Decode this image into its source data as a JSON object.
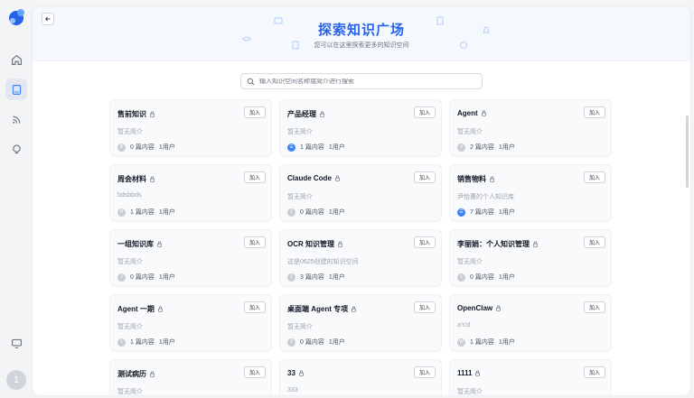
{
  "hero": {
    "title": "探索知识广场",
    "subtitle": "您可以在这里探索更多的知识空间"
  },
  "search": {
    "placeholder": "输入知识空间名称或简介进行搜索"
  },
  "join_label": "加入",
  "user": {
    "avatar_initial": "1"
  },
  "cards": [
    {
      "name": "售前知识",
      "desc": "暂无简介",
      "avatar": "B",
      "avatar_color": "gray",
      "docs": "0 篇内容",
      "users": "1用户"
    },
    {
      "name": "产品经理",
      "desc": "暂无简介",
      "avatar": "☰",
      "avatar_color": "blue",
      "docs": "1 篇内容",
      "users": "1用户"
    },
    {
      "name": "Agent",
      "desc": "暂无简介",
      "avatar": "4",
      "avatar_color": "gray",
      "docs": "2 篇内容",
      "users": "1用户"
    },
    {
      "name": "周会材料",
      "desc": "bdsbbds",
      "avatar": "H",
      "avatar_color": "gray",
      "docs": "1 篇内容",
      "users": "1用户"
    },
    {
      "name": "Claude Code",
      "desc": "暂无简介",
      "avatar": "1",
      "avatar_color": "gray",
      "docs": "0 篇内容",
      "users": "1用户"
    },
    {
      "name": "销售物料",
      "desc": "尹怡惠的个人知识库",
      "avatar": "☰",
      "avatar_color": "blue",
      "docs": "7 篇内容",
      "users": "1用户"
    },
    {
      "name": "一组知识库",
      "desc": "暂无简介",
      "avatar": "J",
      "avatar_color": "gray",
      "docs": "0 篇内容",
      "users": "1用户"
    },
    {
      "name": "OCR 知识管理",
      "desc": "这是0625创建的知识空间",
      "avatar": "1",
      "avatar_color": "gray",
      "docs": "3 篇内容",
      "users": "1用户"
    },
    {
      "name": "李丽娟：个人知识管理",
      "desc": "暂无简介",
      "avatar": "1",
      "avatar_color": "gray",
      "docs": "0 篇内容",
      "users": "1用户"
    },
    {
      "name": "Agent 一期",
      "desc": "暂无简介",
      "avatar": "1",
      "avatar_color": "gray",
      "docs": "1 篇内容",
      "users": "1用户"
    },
    {
      "name": "桌面端 Agent 专项",
      "desc": "暂无简介",
      "avatar": "2",
      "avatar_color": "gray",
      "docs": "0 篇内容",
      "users": "1用户"
    },
    {
      "name": "OpenClaw",
      "desc": "a's'd",
      "avatar": "W",
      "avatar_color": "gray",
      "docs": "1 篇内容",
      "users": "1用户"
    },
    {
      "name": "测试病历",
      "desc": "暂无简介",
      "avatar": "",
      "avatar_color": "gray",
      "docs": "",
      "users": ""
    },
    {
      "name": "33",
      "desc": "333",
      "avatar": "",
      "avatar_color": "gray",
      "docs": "",
      "users": ""
    },
    {
      "name": "1111",
      "desc": "暂无简介",
      "avatar": "",
      "avatar_color": "gray",
      "docs": "",
      "users": ""
    }
  ]
}
